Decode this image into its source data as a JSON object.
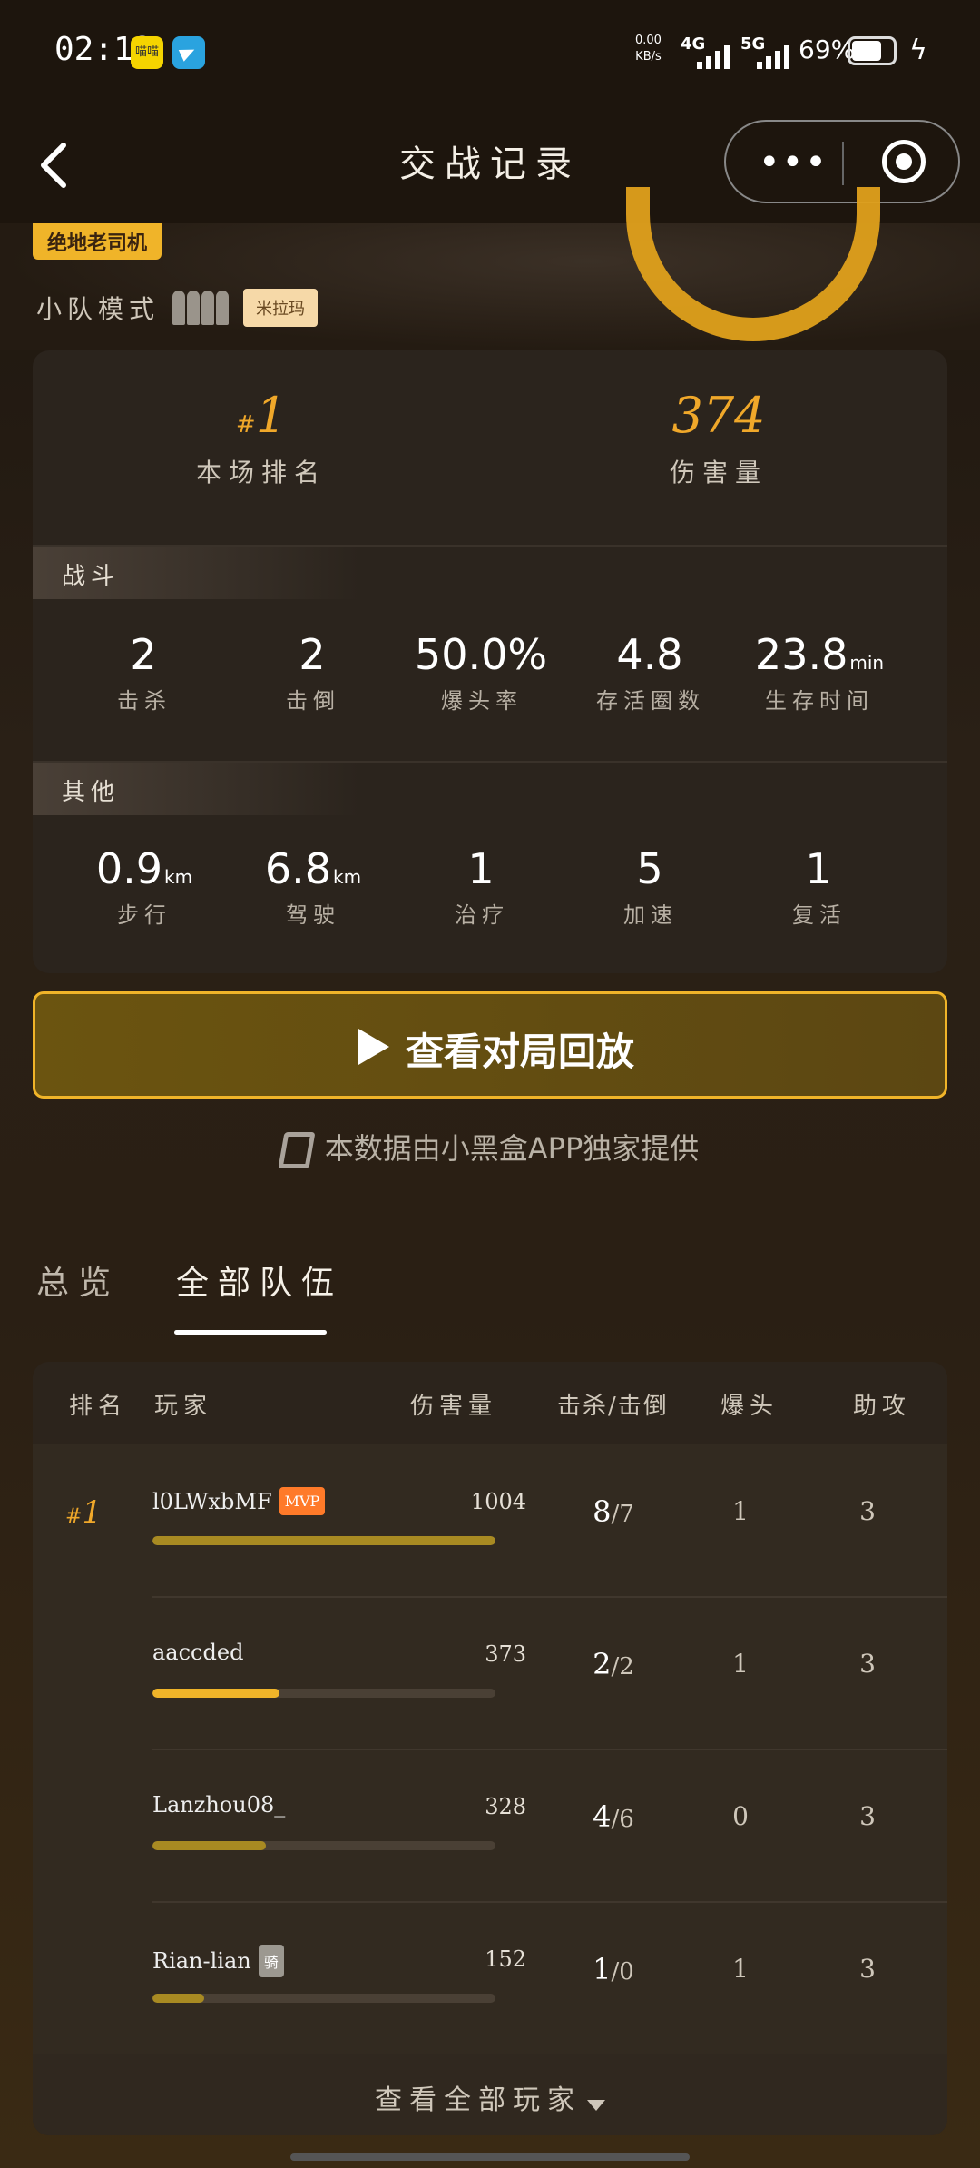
{
  "status_bar": {
    "time": "02:12",
    "app_icon_1": "喵喵",
    "net_speed": "0.00",
    "net_unit": "KB/s",
    "signal_1": "4G",
    "signal_2": "5G",
    "battery": "69%"
  },
  "nav": {
    "title": "交战记录"
  },
  "header": {
    "title_tag": "绝地老司机",
    "mode": "小队模式",
    "map_badge": "米拉玛"
  },
  "summary": {
    "rank_value": "1",
    "rank_prefix": "#",
    "rank_label": "本场排名",
    "damage_value": "374",
    "damage_label": "伤害量"
  },
  "combat": {
    "section_label": "战斗",
    "stats": [
      {
        "value": "2",
        "unit": "",
        "label": "击杀"
      },
      {
        "value": "2",
        "unit": "",
        "label": "击倒"
      },
      {
        "value": "50.0%",
        "unit": "",
        "label": "爆头率"
      },
      {
        "value": "4.8",
        "unit": "",
        "label": "存活圈数"
      },
      {
        "value": "23.8",
        "unit": "min",
        "label": "生存时间"
      }
    ]
  },
  "other": {
    "section_label": "其他",
    "stats": [
      {
        "value": "0.9",
        "unit": "km",
        "label": "步行"
      },
      {
        "value": "6.8",
        "unit": "km",
        "label": "驾驶"
      },
      {
        "value": "1",
        "unit": "",
        "label": "治疗"
      },
      {
        "value": "5",
        "unit": "",
        "label": "加速"
      },
      {
        "value": "1",
        "unit": "",
        "label": "复活"
      }
    ]
  },
  "replay_button": "查看对局回放",
  "provider_text": "本数据由小黑盒APP独家提供",
  "tabs": [
    {
      "label": "总览",
      "active": false
    },
    {
      "label": "全部队伍",
      "active": true
    }
  ],
  "table": {
    "headers": {
      "rank": "排名",
      "player": "玩家",
      "damage": "伤害量",
      "kills_knocks": "击杀/击倒",
      "headshots": "爆头",
      "assists": "助攻"
    },
    "rank_prefix": "#",
    "rank": "1",
    "rows": [
      {
        "name": "l0LWxbMF",
        "badge": "MVP",
        "badge_type": "mvp",
        "damage": "1004",
        "damage_ratio": 1.0,
        "bar_color": "#a88a22",
        "kills": "8",
        "knocks": "7",
        "headshots": "1",
        "assists": "3"
      },
      {
        "name": "aaccded",
        "badge": "",
        "badge_type": "",
        "damage": "373",
        "damage_ratio": 0.37,
        "bar_color": "#f0b429",
        "kills": "2",
        "knocks": "2",
        "headshots": "1",
        "assists": "3"
      },
      {
        "name": "Lanzhou08_",
        "badge": "",
        "badge_type": "",
        "damage": "328",
        "damage_ratio": 0.33,
        "bar_color": "#a88a22",
        "kills": "4",
        "knocks": "6",
        "headshots": "0",
        "assists": "3"
      },
      {
        "name": "Rian-lian",
        "badge": "骑",
        "badge_type": "gray",
        "damage": "152",
        "damage_ratio": 0.15,
        "bar_color": "#a88a22",
        "kills": "1",
        "knocks": "0",
        "headshots": "1",
        "assists": "3"
      }
    ],
    "view_all": "查看全部玩家"
  },
  "colors": {
    "accent": "#f0b429",
    "background": "#221a12",
    "mvp": "#ff7a29"
  }
}
